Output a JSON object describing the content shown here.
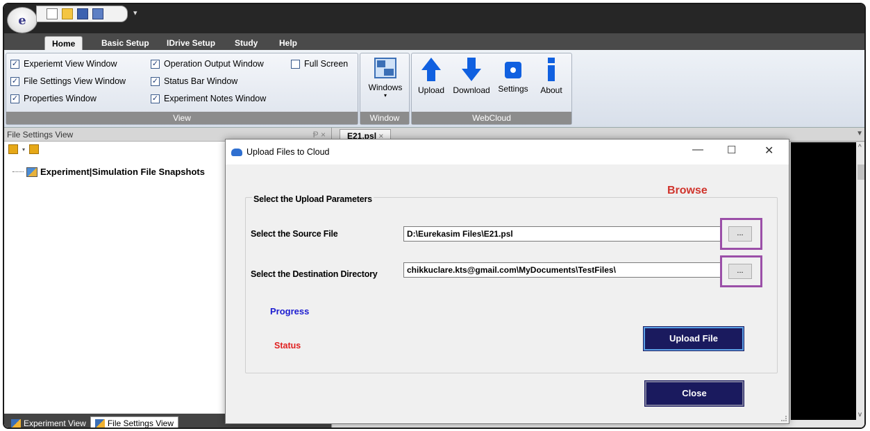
{
  "ribbon": {
    "tabs": [
      "Home",
      "Basic Setup",
      "IDrive Setup",
      "Study",
      "Help"
    ],
    "view_group": {
      "label": "View",
      "checkboxes": [
        {
          "label": "Experiemt View Window",
          "checked": true
        },
        {
          "label": "Operation Output Window",
          "checked": true
        },
        {
          "label": "Full Screen",
          "checked": false
        },
        {
          "label": "File Settings View Window",
          "checked": true
        },
        {
          "label": "Status Bar Window",
          "checked": true
        },
        {
          "label": "Properties Window",
          "checked": true
        },
        {
          "label": "Experiment Notes Window",
          "checked": true
        }
      ]
    },
    "window_group": {
      "label": "Window",
      "button": "Windows"
    },
    "webcloud_group": {
      "label": "WebCloud",
      "buttons": [
        "Upload",
        "Download",
        "Settings",
        "About"
      ]
    }
  },
  "left_pane": {
    "title": "File Settings View",
    "pin": "Ᵽ ×",
    "tree_root": "Experiment|Simulation File Snapshots",
    "bottom_tabs": [
      "Experiment View",
      "File Settings View"
    ]
  },
  "doc": {
    "tab_label": "E21.psl"
  },
  "dialog": {
    "title": "Upload Files to Cloud",
    "group_title": "Select the Upload Parameters",
    "browse_annotation": "Browse",
    "source_label": "Select the Source File",
    "source_value": "D:\\Eurekasim Files\\E21.psl",
    "dest_label": "Select the Destination Directory",
    "dest_value": "chikkuclare.kts@gmail.com\\MyDocuments\\TestFiles\\",
    "dots_label": "...",
    "progress_label": "Progress",
    "status_label": "Status",
    "upload_button": "Upload File",
    "close_button": "Close"
  }
}
